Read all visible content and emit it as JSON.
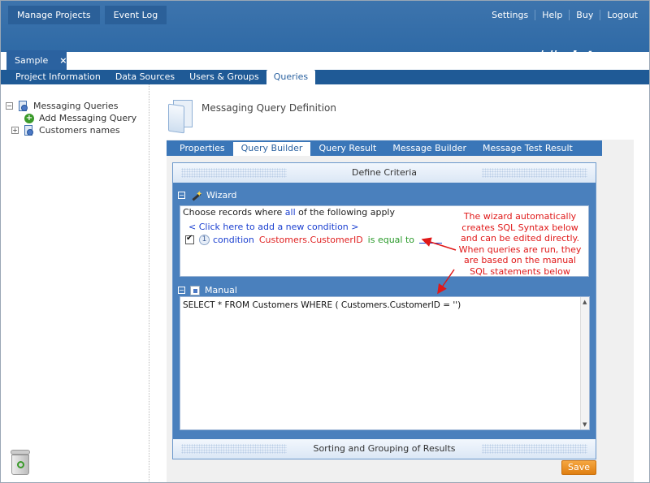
{
  "topbar": {
    "left_buttons": [
      "Manage Projects",
      "Event Log"
    ],
    "right_links": [
      "Settings",
      "Help",
      "Buy",
      "Logout"
    ]
  },
  "project_tab": {
    "label": "Sample",
    "close": "×"
  },
  "logo": {
    "part1": "mobile",
    "part2": "data",
    "part3": " now"
  },
  "main_tabs": [
    "Project Information",
    "Data Sources",
    "Users & Groups",
    "Queries"
  ],
  "main_tabs_active": "Queries",
  "tree": {
    "root": {
      "toggle": "⊟",
      "label": "Messaging Queries"
    },
    "add": {
      "label": "Add Messaging Query"
    },
    "child": {
      "toggle": "⊞",
      "label": "Customers names"
    }
  },
  "page": {
    "title": "Messaging Query Definition",
    "subtabs": [
      "Properties",
      "Query Builder",
      "Query Result",
      "Message Builder",
      "Message Test Result"
    ],
    "active_subtab": "Query Builder"
  },
  "criteria": {
    "header": "Define Criteria",
    "wizard_label": "Wizard",
    "wizard_line_prefix": "Choose records where",
    "wizard_line_all": "all",
    "wizard_line_suffix": "of the following apply",
    "add_condition": "< Click here to add a new condition >",
    "condition": {
      "number": "1",
      "word": "condition",
      "field": "Customers.CustomerID",
      "operator": "is equal to"
    },
    "note_lines": [
      "The wizard automatically",
      "creates SQL Syntax below",
      "and can be edited directly.",
      "When queries are run, they",
      "are based on the manual",
      "SQL statements below"
    ],
    "manual_label": "Manual",
    "manual_sql": "SELECT * FROM Customers WHERE ( Customers.CustomerID  = '')",
    "footer": "Sorting and Grouping of Results"
  },
  "save_label": "Save",
  "colors": {
    "top_bar": "#3d74ad",
    "tab_bar": "#1f5a96",
    "panel": "#4a80bd",
    "save": "#e8901f",
    "note": "#e01818"
  }
}
